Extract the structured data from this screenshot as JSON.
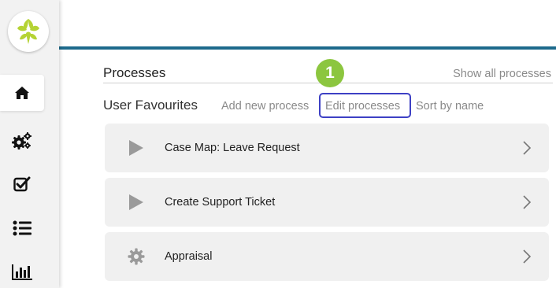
{
  "sidebar": {
    "items": [
      {
        "icon": "home-icon",
        "active": true
      },
      {
        "icon": "gears-icon",
        "active": false
      },
      {
        "icon": "checkbox-icon",
        "active": false
      },
      {
        "icon": "list-icon",
        "active": false
      },
      {
        "icon": "chart-icon",
        "active": false
      }
    ]
  },
  "main": {
    "section_title": "Processes",
    "show_all_label": "Show all processes",
    "favourites_title": "User Favourites",
    "actions": {
      "add_new": "Add new process",
      "edit": "Edit processes",
      "sort": "Sort by name"
    },
    "step_badge": "1",
    "processes": [
      {
        "label": "Case Map: Leave Request",
        "icon": "play-icon"
      },
      {
        "label": "Create Support Ticket",
        "icon": "play-icon"
      },
      {
        "label": "Appraisal",
        "icon": "gear-icon"
      }
    ]
  },
  "colors": {
    "accent_bar": "#1d6a8c",
    "highlight": "#3d40c4",
    "badge": "#8cc63f",
    "logo_leaf": "#b5d334"
  }
}
